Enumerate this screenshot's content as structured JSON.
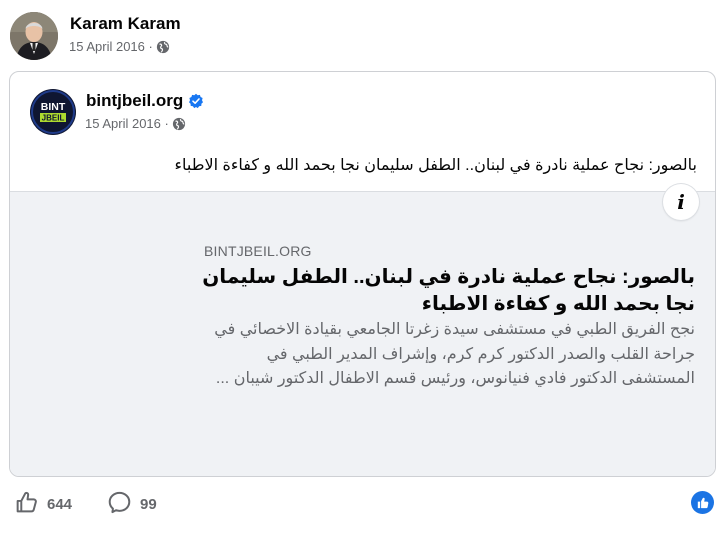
{
  "post": {
    "author": "Karam Karam",
    "date": "15 April 2016 ·"
  },
  "shared": {
    "page_name": "bintjbeil.org",
    "date": "15 April 2016 ·",
    "logo_text_top": "BINT",
    "logo_text_bottom": "JBEIL",
    "caption": "بالصور: نجاح عملية نادرة في لبنان.. الطفل سليمان نجا بحمد الله و كفاءة الاطباء"
  },
  "link_preview": {
    "info_label": "i",
    "domain": "BINTJBEIL.ORG",
    "title": "بالصور: نجاح عملية نادرة في لبنان.. الطفل سليمان نجا بحمد الله و كفاءة الاطباء",
    "description": "نجح الفريق الطبي في مستشفى سيدة زغرتا الجامعي بقيادة الاخصائي في جراحة القلب والصدر الدكتور كرم كرم، وإشراف المدير الطبي في المستشفى الدكتور فادي فنيانوس، ورئيس قسم الاطفال الدكتور شيبان ..."
  },
  "reactions": {
    "likes": "644",
    "comments": "99"
  },
  "colors": {
    "accent": "#1b74e4",
    "verified": "#1877f2",
    "secondary_text": "#65676b",
    "preview_bg": "#f0f2f5",
    "logo_ring": "#aedb2f"
  },
  "icons": {
    "globe": "globe-icon",
    "verified": "verified-badge-icon",
    "info": "info-icon",
    "like": "thumbs-up-icon",
    "comment": "comment-bubble-icon",
    "share": "share-icon"
  }
}
